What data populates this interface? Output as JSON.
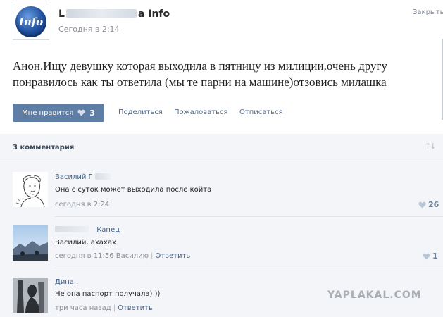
{
  "post": {
    "author_start": "L",
    "author_end": "a Info",
    "avatar_text": "Info",
    "time": "Сегодня в 2:14",
    "close_label": "Закрыть",
    "text": "Анон.Ищу девушку которая выходила в пятницу из милиции,очень другу понравилось как ты ответила (мы те парни на машине)отзовись милашка"
  },
  "actions": {
    "like_label": "Мне нравится",
    "like_count": "3",
    "share": "Поделиться",
    "report": "Пожаловаться",
    "unsubscribe": "Отписаться"
  },
  "comments_header": {
    "count_label": "3 комментария"
  },
  "comments": [
    {
      "name": "Василий Г",
      "text": "Она с суток может выходила после койта",
      "time": "сегодня в 2:24",
      "likes": "26"
    },
    {
      "name": "Капец",
      "text": "Василий, ахахах",
      "time": "сегодня в 11:56 Василию",
      "reply": "Ответить",
      "likes": "1"
    },
    {
      "name": "Дина .",
      "text": "Не она паспорт получала) ))",
      "time": "три часа назад",
      "reply": "Ответить"
    }
  ],
  "watermark": "YAPLAKAL.COM",
  "colors": {
    "accent": "#5f7ea5",
    "link": "#3f5f8a",
    "muted": "#8a8f96",
    "comments_bg": "#f3f5f8"
  },
  "icons": [
    "heart-icon",
    "sort-arrows-icon"
  ]
}
